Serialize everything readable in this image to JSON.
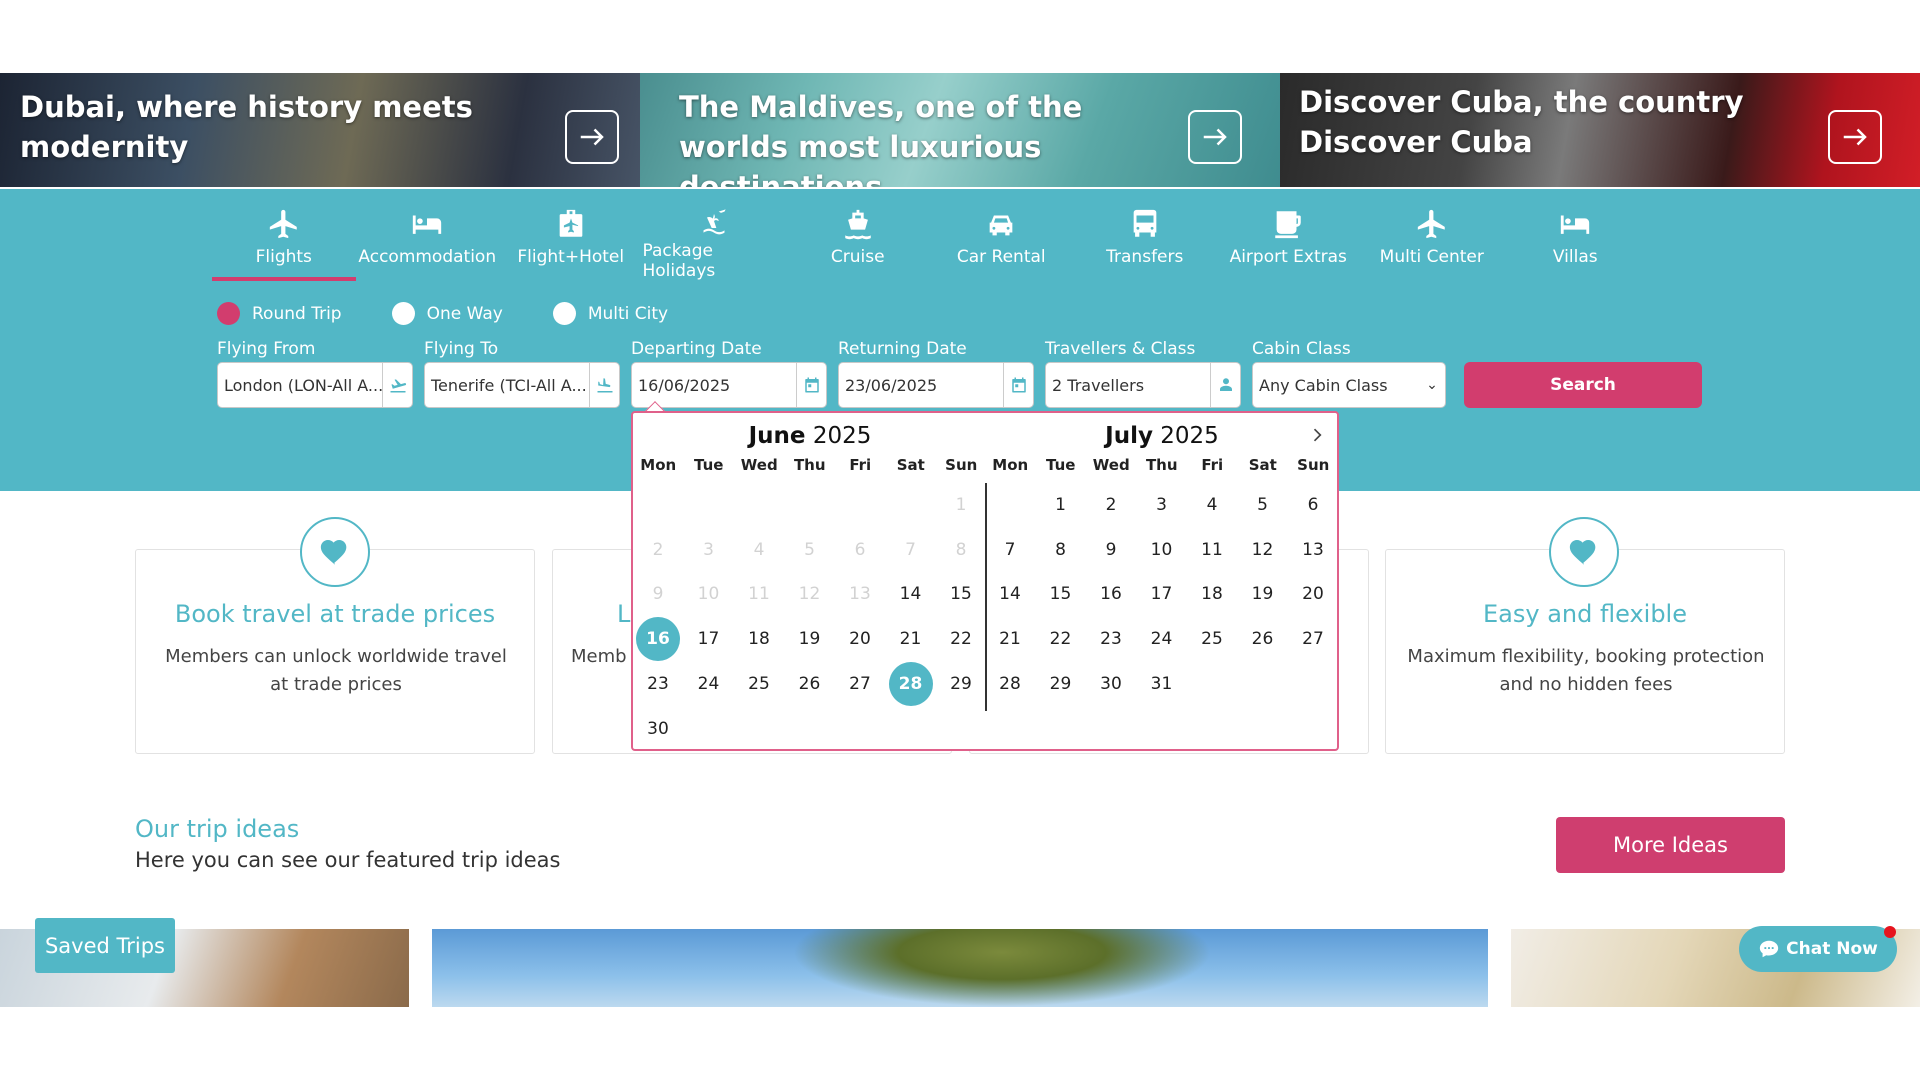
{
  "banners": [
    {
      "title": "Dubai, where history meets modernity"
    },
    {
      "title": "The Maldives, one of the worlds most luxurious destinations"
    },
    {
      "title": "Discover Cuba, the country Discover Cuba"
    }
  ],
  "tabs": [
    {
      "label": "Flights",
      "icon": "plane-icon",
      "active": true
    },
    {
      "label": "Accommodation",
      "icon": "bed-icon"
    },
    {
      "label": "Flight+Hotel",
      "icon": "luggage-plane-icon"
    },
    {
      "label": "Package Holidays",
      "icon": "beach-plane-icon"
    },
    {
      "label": "Cruise",
      "icon": "ship-icon"
    },
    {
      "label": "Car Rental",
      "icon": "car-icon"
    },
    {
      "label": "Transfers",
      "icon": "bus-icon"
    },
    {
      "label": "Airport Extras",
      "icon": "coffee-icon"
    },
    {
      "label": "Multi Center",
      "icon": "plane-icon"
    },
    {
      "label": "Villas",
      "icon": "bed-icon"
    }
  ],
  "trip_type": [
    {
      "label": "Round Trip",
      "checked": true
    },
    {
      "label": "One Way",
      "checked": false
    },
    {
      "label": "Multi City",
      "checked": false
    }
  ],
  "form": {
    "from_label": "Flying From",
    "from_value": "London (LON-All A...",
    "to_label": "Flying To",
    "to_value": "Tenerife (TCI-All A...",
    "depart_label": "Departing Date",
    "depart_value": "16/06/2025",
    "return_label": "Returning Date",
    "return_value": "23/06/2025",
    "travellers_label": "Travellers & Class",
    "travellers_value": "2 Travellers",
    "cabin_label": "Cabin Class",
    "cabin_value": "Any Cabin Class",
    "search_label": "Search"
  },
  "calendar": {
    "weekdays": [
      "Mon",
      "Tue",
      "Wed",
      "Thu",
      "Fri",
      "Sat",
      "Sun"
    ],
    "months": [
      {
        "name": "June",
        "year": "2025"
      },
      {
        "name": "July",
        "year": "2025"
      }
    ],
    "selected_start": "16",
    "selected_end": "28"
  },
  "cards": [
    {
      "title": "Book travel at trade prices",
      "desc": "Members can unlock worldwide travel at trade prices",
      "icon": "heart-icon"
    },
    {
      "title": "Easy and flexible",
      "desc": "Maximum flexibility, booking protection and no hidden fees",
      "icon": "heart-icon"
    }
  ],
  "card_partial": {
    "title": "L",
    "desc": "Memb"
  },
  "ideas": {
    "title": "Our trip ideas",
    "subtitle": "Here you can see our featured trip ideas",
    "more_label": "More Ideas"
  },
  "saved_trips_label": "Saved Trips",
  "chat_label": "Chat Now",
  "colors": {
    "teal": "#52b7c6",
    "pink": "#d23d6e"
  }
}
